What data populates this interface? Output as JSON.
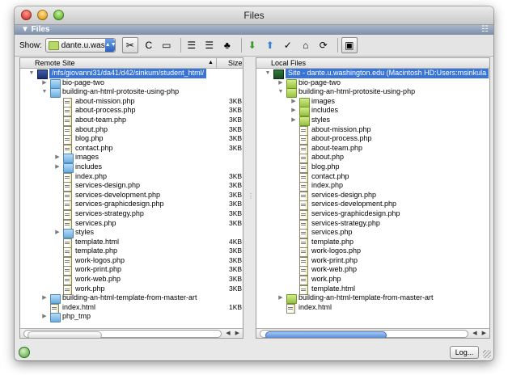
{
  "window": {
    "title": "Files"
  },
  "panel": {
    "title": "▼ Files",
    "options_glyph": "☷"
  },
  "toolbar": {
    "show_label": "Show:",
    "site_select_value": "dante.u.was...",
    "buttons": [
      {
        "name": "connect-icon",
        "glyph": "✂"
      },
      {
        "name": "refresh-icon",
        "glyph": "C"
      },
      {
        "name": "view-site-files-icon",
        "glyph": "▭"
      },
      {
        "name": "testing-server-icon",
        "glyph": "☰"
      },
      {
        "name": "repository-icon",
        "glyph": "☰"
      },
      {
        "name": "site-map-icon",
        "glyph": "♣"
      },
      {
        "name": "get-files-icon",
        "glyph": "⬇"
      },
      {
        "name": "put-files-icon",
        "glyph": "⬆"
      },
      {
        "name": "check-out-icon",
        "glyph": "✓"
      },
      {
        "name": "check-in-icon",
        "glyph": "⌂"
      },
      {
        "name": "synchronize-icon",
        "glyph": "⟳"
      },
      {
        "name": "expand-collapse-icon",
        "glyph": "▣"
      }
    ],
    "colors": {
      "select_arrow": "#2a62c0",
      "get_arrow": "#3a9a2a",
      "put_arrow": "#3a7fd7"
    }
  },
  "remote": {
    "header_name": "Remote Site",
    "header_size": "Size",
    "rows": [
      {
        "depth": 0,
        "tri": "▼",
        "icon": "site-remote",
        "label": "/nfs/giovanni31/da41/d42/sinkum/student_html/",
        "size": "",
        "selected": true
      },
      {
        "depth": 1,
        "tri": "▶",
        "icon": "folder-remote",
        "label": "bio-page-two",
        "size": ""
      },
      {
        "depth": 1,
        "tri": "▼",
        "icon": "folder-remote",
        "label": "building-an-html-protosite-using-php",
        "size": ""
      },
      {
        "depth": 2,
        "tri": "",
        "icon": "file",
        "label": "about-mission.php",
        "size": "3KB"
      },
      {
        "depth": 2,
        "tri": "",
        "icon": "file",
        "label": "about-process.php",
        "size": "3KB"
      },
      {
        "depth": 2,
        "tri": "",
        "icon": "file",
        "label": "about-team.php",
        "size": "3KB"
      },
      {
        "depth": 2,
        "tri": "",
        "icon": "file",
        "label": "about.php",
        "size": "3KB"
      },
      {
        "depth": 2,
        "tri": "",
        "icon": "file",
        "label": "blog.php",
        "size": "3KB"
      },
      {
        "depth": 2,
        "tri": "",
        "icon": "file",
        "label": "contact.php",
        "size": "3KB"
      },
      {
        "depth": 2,
        "tri": "▶",
        "icon": "folder-remote",
        "label": "images",
        "size": ""
      },
      {
        "depth": 2,
        "tri": "▶",
        "icon": "folder-remote",
        "label": "includes",
        "size": ""
      },
      {
        "depth": 2,
        "tri": "",
        "icon": "file",
        "label": "index.php",
        "size": "3KB"
      },
      {
        "depth": 2,
        "tri": "",
        "icon": "file",
        "label": "services-design.php",
        "size": "3KB"
      },
      {
        "depth": 2,
        "tri": "",
        "icon": "file",
        "label": "services-development.php",
        "size": "3KB"
      },
      {
        "depth": 2,
        "tri": "",
        "icon": "file",
        "label": "services-graphicdesign.php",
        "size": "3KB"
      },
      {
        "depth": 2,
        "tri": "",
        "icon": "file",
        "label": "services-strategy.php",
        "size": "3KB"
      },
      {
        "depth": 2,
        "tri": "",
        "icon": "file",
        "label": "services.php",
        "size": "3KB"
      },
      {
        "depth": 2,
        "tri": "▶",
        "icon": "folder-remote",
        "label": "styles",
        "size": ""
      },
      {
        "depth": 2,
        "tri": "",
        "icon": "file",
        "label": "template.html",
        "size": "4KB"
      },
      {
        "depth": 2,
        "tri": "",
        "icon": "file",
        "label": "template.php",
        "size": "3KB"
      },
      {
        "depth": 2,
        "tri": "",
        "icon": "file",
        "label": "work-logos.php",
        "size": "3KB"
      },
      {
        "depth": 2,
        "tri": "",
        "icon": "file",
        "label": "work-print.php",
        "size": "3KB"
      },
      {
        "depth": 2,
        "tri": "",
        "icon": "file",
        "label": "work-web.php",
        "size": "3KB"
      },
      {
        "depth": 2,
        "tri": "",
        "icon": "file",
        "label": "work.php",
        "size": "3KB"
      },
      {
        "depth": 1,
        "tri": "▶",
        "icon": "folder-remote",
        "label": "building-an-html-template-from-master-art",
        "size": ""
      },
      {
        "depth": 1,
        "tri": "",
        "icon": "file",
        "label": "index.html",
        "size": "1KB"
      },
      {
        "depth": 1,
        "tri": "▶",
        "icon": "folder-remote",
        "label": "php_tmp",
        "size": ""
      }
    ]
  },
  "local": {
    "header_name": "Local Files",
    "rows": [
      {
        "depth": 0,
        "tri": "▼",
        "icon": "site-local",
        "label": "Site - dante.u.washington.edu (Macintosh HD:Users:msinkula",
        "selected": true
      },
      {
        "depth": 1,
        "tri": "▶",
        "icon": "folder-local",
        "label": "bio-page-two"
      },
      {
        "depth": 1,
        "tri": "▼",
        "icon": "folder-local",
        "label": "building-an-html-protosite-using-php"
      },
      {
        "depth": 2,
        "tri": "▶",
        "icon": "folder-local",
        "label": "images"
      },
      {
        "depth": 2,
        "tri": "▶",
        "icon": "folder-local",
        "label": "includes"
      },
      {
        "depth": 2,
        "tri": "▶",
        "icon": "folder-local",
        "label": "styles"
      },
      {
        "depth": 2,
        "tri": "",
        "icon": "file",
        "label": "about-mission.php"
      },
      {
        "depth": 2,
        "tri": "",
        "icon": "file",
        "label": "about-process.php"
      },
      {
        "depth": 2,
        "tri": "",
        "icon": "file",
        "label": "about-team.php"
      },
      {
        "depth": 2,
        "tri": "",
        "icon": "file",
        "label": "about.php"
      },
      {
        "depth": 2,
        "tri": "",
        "icon": "file",
        "label": "blog.php"
      },
      {
        "depth": 2,
        "tri": "",
        "icon": "file",
        "label": "contact.php"
      },
      {
        "depth": 2,
        "tri": "",
        "icon": "file",
        "label": "index.php"
      },
      {
        "depth": 2,
        "tri": "",
        "icon": "file",
        "label": "services-design.php"
      },
      {
        "depth": 2,
        "tri": "",
        "icon": "file",
        "label": "services-development.php"
      },
      {
        "depth": 2,
        "tri": "",
        "icon": "file",
        "label": "services-graphicdesign.php"
      },
      {
        "depth": 2,
        "tri": "",
        "icon": "file",
        "label": "services-strategy.php"
      },
      {
        "depth": 2,
        "tri": "",
        "icon": "file",
        "label": "services.php"
      },
      {
        "depth": 2,
        "tri": "",
        "icon": "file",
        "label": "template.php"
      },
      {
        "depth": 2,
        "tri": "",
        "icon": "file",
        "label": "work-logos.php"
      },
      {
        "depth": 2,
        "tri": "",
        "icon": "file",
        "label": "work-print.php"
      },
      {
        "depth": 2,
        "tri": "",
        "icon": "file",
        "label": "work-web.php"
      },
      {
        "depth": 2,
        "tri": "",
        "icon": "file",
        "label": "work.php"
      },
      {
        "depth": 2,
        "tri": "",
        "icon": "file",
        "label": "template.html"
      },
      {
        "depth": 1,
        "tri": "▶",
        "icon": "folder-local",
        "label": "building-an-html-template-from-master-art"
      },
      {
        "depth": 1,
        "tri": "",
        "icon": "file",
        "label": "index.html"
      }
    ]
  },
  "status": {
    "log_label": "Log..."
  },
  "colors": {
    "selection": "#3875d7",
    "panel_bar": "#7d8fa8"
  }
}
